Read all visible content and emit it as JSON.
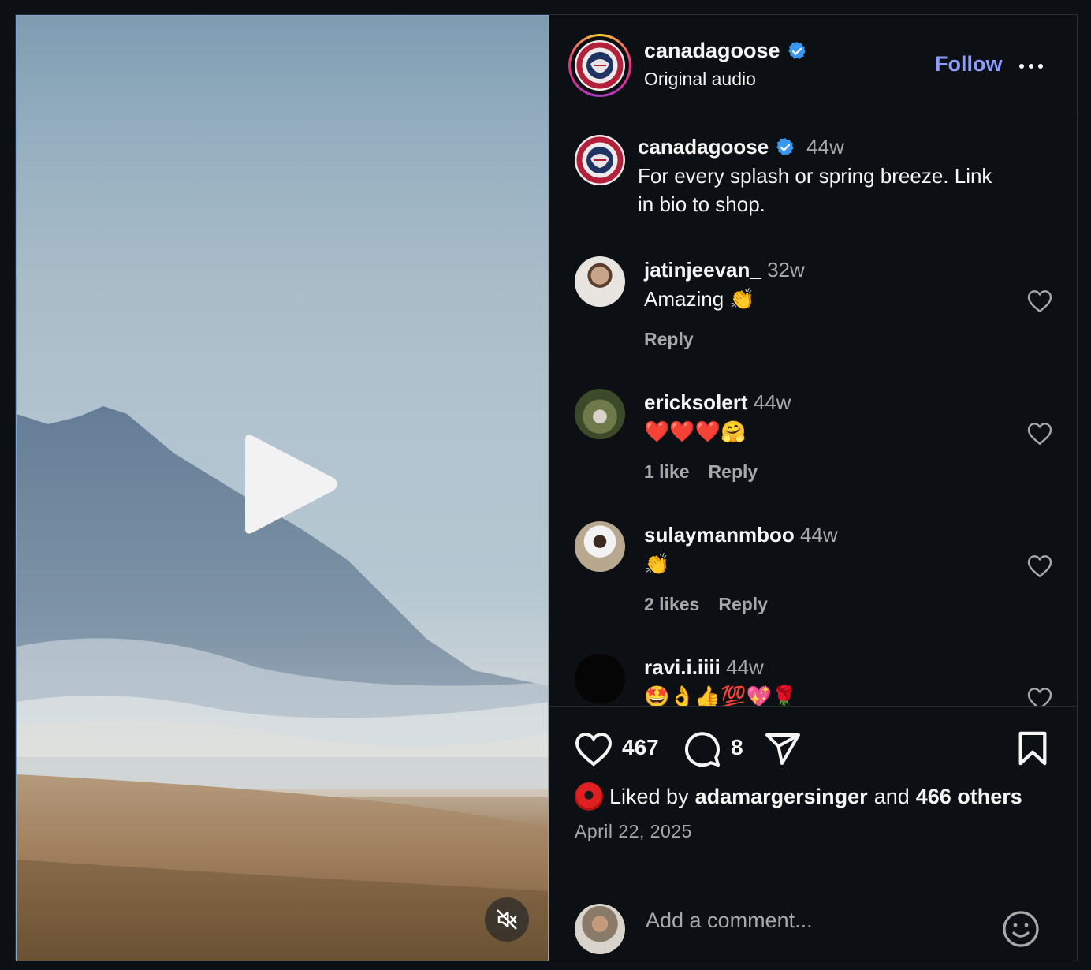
{
  "post": {
    "username": "canadagoose",
    "audio": "Original audio",
    "follow_label": "Follow",
    "caption_time": "44w",
    "caption_text": "For every splash or spring breeze. Link in bio to shop.",
    "caption_line1": "For every splash or spring breeze. Link",
    "caption_line2": "in bio to shop."
  },
  "comments": [
    {
      "user": "jatinjeevan_",
      "time": "32w",
      "text": "Amazing 👏",
      "likes": "",
      "reply": "Reply"
    },
    {
      "user": "ericksolert",
      "time": "44w",
      "text": "❤️❤️❤️🤗",
      "likes": "1 like",
      "reply": "Reply"
    },
    {
      "user": "sulaymanmboo",
      "time": "44w",
      "text": "👏",
      "likes": "2 likes",
      "reply": "Reply"
    },
    {
      "user": "ravi.i.iiii",
      "time": "44w",
      "text": "🤩👌👍💯💖🌹",
      "likes": "",
      "reply": ""
    }
  ],
  "stats": {
    "likes": "467",
    "comments": "8",
    "liked_by_prefix": "Liked by",
    "liked_by_user": "adamargersinger",
    "liked_by_and": "and",
    "liked_by_others": "466 others",
    "date": "April 22, 2025"
  },
  "composer": {
    "placeholder": "Add a comment..."
  },
  "colors": {
    "accent": "#8d9cff",
    "verified": "#3897f0",
    "background": "#0c1014"
  },
  "icons": [
    "verified-badge-icon",
    "more-icon",
    "play-icon",
    "mute-icon",
    "heart-icon",
    "comment-icon",
    "share-icon",
    "bookmark-icon",
    "emoji-icon"
  ]
}
